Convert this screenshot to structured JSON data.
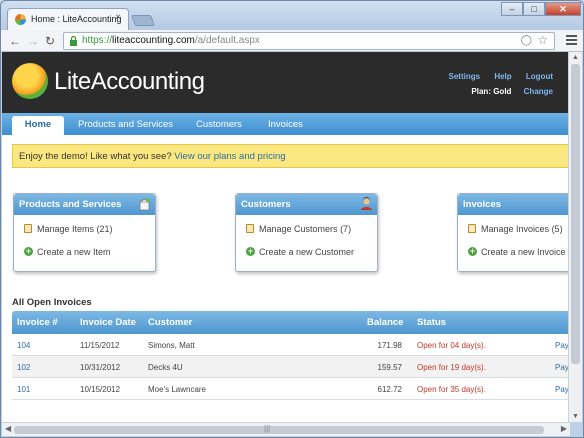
{
  "browser": {
    "tab_title": "Home : LiteAccounting",
    "tab_close": "×",
    "url_scheme": "https://",
    "url_domain": "liteaccounting.com",
    "url_path": "/a/default.aspx",
    "window_buttons": {
      "minimize": "–",
      "maximize": "□",
      "close": "✕"
    }
  },
  "site": {
    "logo_text": "LiteAccounting",
    "top_links": [
      "Settings",
      "Help",
      "Logout"
    ],
    "plan_label": "Plan: Gold",
    "change_label": "Change"
  },
  "nav": {
    "items": [
      "Home",
      "Products and Services",
      "Customers",
      "Invoices"
    ]
  },
  "banner": {
    "text": "Enjoy the demo! Like what you see?",
    "link": "View our plans and pricing"
  },
  "widgets": [
    {
      "title": "Products and Services",
      "manage_label": "Manage Items",
      "count": "(21)",
      "create_label": "Create a new Item"
    },
    {
      "title": "Customers",
      "manage_label": "Manage Customers",
      "count": "(7)",
      "create_label": "Create a new Customer"
    },
    {
      "title": "Invoices",
      "manage_label": "Manage Invoices",
      "count": "(5)",
      "create_label": "Create a new Invoice"
    }
  ],
  "open_invoices": {
    "title": "All Open Invoices",
    "columns": [
      "Invoice #",
      "Invoice Date",
      "Customer",
      "Balance",
      "Status"
    ],
    "rows": [
      {
        "number": "104",
        "date": "11/15/2012",
        "customer": "Simons, Matt",
        "balance": "171.98",
        "status": "Open for 04 day(s).",
        "action": "Pay"
      },
      {
        "number": "102",
        "date": "10/31/2012",
        "customer": "Decks 4U",
        "balance": "159.57",
        "status": "Open for 19 day(s).",
        "action": "Pay"
      },
      {
        "number": "101",
        "date": "10/15/2012",
        "customer": "Moe's Lawncare",
        "balance": "612.72",
        "status": "Open for 35 day(s).",
        "action": "Pay"
      }
    ]
  },
  "colors": {
    "header_bg": "#2b2b2b",
    "nav_blue": "#4f97d0",
    "link_blue": "#2c6ea8",
    "banner_yellow": "#fbe77f",
    "status_red": "#c0392b"
  },
  "icons": {
    "nav_back": "back-arrow-icon",
    "nav_forward": "forward-arrow-icon",
    "nav_reload": "reload-icon",
    "lock": "lock-icon",
    "bookmark": "star-icon",
    "menu": "hamburger-menu-icon",
    "manage": "clipboard-icon",
    "create": "plus-circle-icon"
  }
}
